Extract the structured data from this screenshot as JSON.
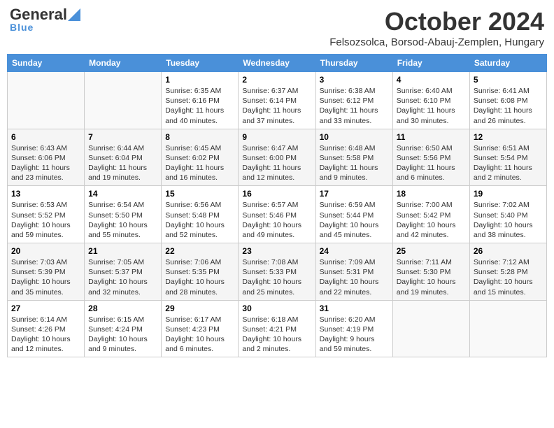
{
  "header": {
    "logo_general": "General",
    "logo_blue": "Blue",
    "month_title": "October 2024",
    "location": "Felsozsolca, Borsod-Abauj-Zemplen, Hungary"
  },
  "days_of_week": [
    "Sunday",
    "Monday",
    "Tuesday",
    "Wednesday",
    "Thursday",
    "Friday",
    "Saturday"
  ],
  "weeks": [
    {
      "row": 1,
      "days": [
        {
          "num": "",
          "info": ""
        },
        {
          "num": "",
          "info": ""
        },
        {
          "num": "1",
          "info": "Sunrise: 6:35 AM\nSunset: 6:16 PM\nDaylight: 11 hours and 40 minutes."
        },
        {
          "num": "2",
          "info": "Sunrise: 6:37 AM\nSunset: 6:14 PM\nDaylight: 11 hours and 37 minutes."
        },
        {
          "num": "3",
          "info": "Sunrise: 6:38 AM\nSunset: 6:12 PM\nDaylight: 11 hours and 33 minutes."
        },
        {
          "num": "4",
          "info": "Sunrise: 6:40 AM\nSunset: 6:10 PM\nDaylight: 11 hours and 30 minutes."
        },
        {
          "num": "5",
          "info": "Sunrise: 6:41 AM\nSunset: 6:08 PM\nDaylight: 11 hours and 26 minutes."
        }
      ]
    },
    {
      "row": 2,
      "days": [
        {
          "num": "6",
          "info": "Sunrise: 6:43 AM\nSunset: 6:06 PM\nDaylight: 11 hours and 23 minutes."
        },
        {
          "num": "7",
          "info": "Sunrise: 6:44 AM\nSunset: 6:04 PM\nDaylight: 11 hours and 19 minutes."
        },
        {
          "num": "8",
          "info": "Sunrise: 6:45 AM\nSunset: 6:02 PM\nDaylight: 11 hours and 16 minutes."
        },
        {
          "num": "9",
          "info": "Sunrise: 6:47 AM\nSunset: 6:00 PM\nDaylight: 11 hours and 12 minutes."
        },
        {
          "num": "10",
          "info": "Sunrise: 6:48 AM\nSunset: 5:58 PM\nDaylight: 11 hours and 9 minutes."
        },
        {
          "num": "11",
          "info": "Sunrise: 6:50 AM\nSunset: 5:56 PM\nDaylight: 11 hours and 6 minutes."
        },
        {
          "num": "12",
          "info": "Sunrise: 6:51 AM\nSunset: 5:54 PM\nDaylight: 11 hours and 2 minutes."
        }
      ]
    },
    {
      "row": 3,
      "days": [
        {
          "num": "13",
          "info": "Sunrise: 6:53 AM\nSunset: 5:52 PM\nDaylight: 10 hours and 59 minutes."
        },
        {
          "num": "14",
          "info": "Sunrise: 6:54 AM\nSunset: 5:50 PM\nDaylight: 10 hours and 55 minutes."
        },
        {
          "num": "15",
          "info": "Sunrise: 6:56 AM\nSunset: 5:48 PM\nDaylight: 10 hours and 52 minutes."
        },
        {
          "num": "16",
          "info": "Sunrise: 6:57 AM\nSunset: 5:46 PM\nDaylight: 10 hours and 49 minutes."
        },
        {
          "num": "17",
          "info": "Sunrise: 6:59 AM\nSunset: 5:44 PM\nDaylight: 10 hours and 45 minutes."
        },
        {
          "num": "18",
          "info": "Sunrise: 7:00 AM\nSunset: 5:42 PM\nDaylight: 10 hours and 42 minutes."
        },
        {
          "num": "19",
          "info": "Sunrise: 7:02 AM\nSunset: 5:40 PM\nDaylight: 10 hours and 38 minutes."
        }
      ]
    },
    {
      "row": 4,
      "days": [
        {
          "num": "20",
          "info": "Sunrise: 7:03 AM\nSunset: 5:39 PM\nDaylight: 10 hours and 35 minutes."
        },
        {
          "num": "21",
          "info": "Sunrise: 7:05 AM\nSunset: 5:37 PM\nDaylight: 10 hours and 32 minutes."
        },
        {
          "num": "22",
          "info": "Sunrise: 7:06 AM\nSunset: 5:35 PM\nDaylight: 10 hours and 28 minutes."
        },
        {
          "num": "23",
          "info": "Sunrise: 7:08 AM\nSunset: 5:33 PM\nDaylight: 10 hours and 25 minutes."
        },
        {
          "num": "24",
          "info": "Sunrise: 7:09 AM\nSunset: 5:31 PM\nDaylight: 10 hours and 22 minutes."
        },
        {
          "num": "25",
          "info": "Sunrise: 7:11 AM\nSunset: 5:30 PM\nDaylight: 10 hours and 19 minutes."
        },
        {
          "num": "26",
          "info": "Sunrise: 7:12 AM\nSunset: 5:28 PM\nDaylight: 10 hours and 15 minutes."
        }
      ]
    },
    {
      "row": 5,
      "days": [
        {
          "num": "27",
          "info": "Sunrise: 6:14 AM\nSunset: 4:26 PM\nDaylight: 10 hours and 12 minutes."
        },
        {
          "num": "28",
          "info": "Sunrise: 6:15 AM\nSunset: 4:24 PM\nDaylight: 10 hours and 9 minutes."
        },
        {
          "num": "29",
          "info": "Sunrise: 6:17 AM\nSunset: 4:23 PM\nDaylight: 10 hours and 6 minutes."
        },
        {
          "num": "30",
          "info": "Sunrise: 6:18 AM\nSunset: 4:21 PM\nDaylight: 10 hours and 2 minutes."
        },
        {
          "num": "31",
          "info": "Sunrise: 6:20 AM\nSunset: 4:19 PM\nDaylight: 9 hours and 59 minutes."
        },
        {
          "num": "",
          "info": ""
        },
        {
          "num": "",
          "info": ""
        }
      ]
    }
  ]
}
